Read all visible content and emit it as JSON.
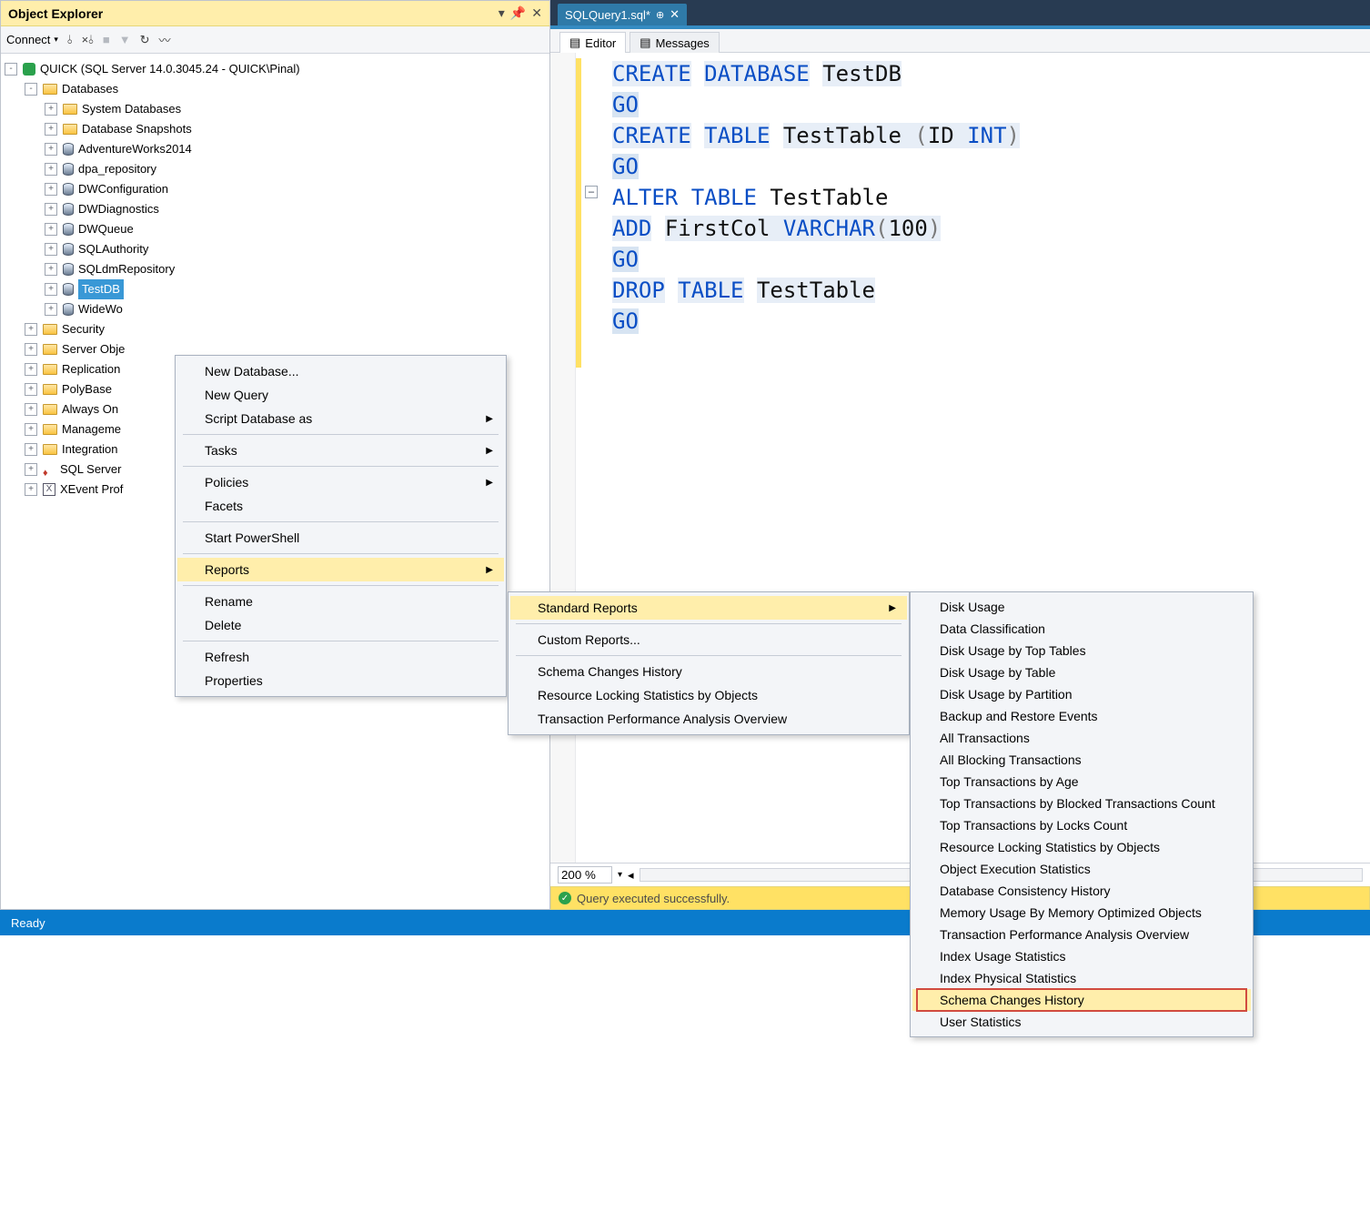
{
  "colors": {
    "accent": "#358bc2",
    "highlight_bg": "#ffeeab",
    "status_bar": "#0a7bcc",
    "warn_bar": "#ffe164",
    "red_box": "#d14b3f"
  },
  "object_explorer": {
    "title": "Object Explorer",
    "connect_label": "Connect",
    "root": "QUICK (SQL Server 14.0.3045.24 - QUICK\\Pinal)",
    "databases_label": "Databases",
    "db_children": [
      "System Databases",
      "Database Snapshots",
      "AdventureWorks2014",
      "dpa_repository",
      "DWConfiguration",
      "DWDiagnostics",
      "DWQueue",
      "SQLAuthority",
      "SQLdmRepository",
      "TestDB",
      "WideWo"
    ],
    "db_kinds": [
      "folder",
      "folder",
      "db",
      "db",
      "db",
      "db",
      "db",
      "db",
      "db",
      "db",
      "db"
    ],
    "selected_index": 9,
    "server_nodes": [
      "Security",
      "Server Obje",
      "Replication",
      "PolyBase",
      "Always On",
      "Manageme",
      "Integration",
      "SQL Server",
      "XEvent Prof"
    ],
    "server_kinds": [
      "folder",
      "folder",
      "folder",
      "folder",
      "folder",
      "folder",
      "folder",
      "sql",
      "xe"
    ]
  },
  "context_menu": {
    "items": [
      "New Database...",
      "New Query",
      "Script Database as",
      "-",
      "Tasks",
      "-",
      "Policies",
      "Facets",
      "-",
      "Start PowerShell",
      "-",
      "Reports",
      "-",
      "Rename",
      "Delete",
      "-",
      "Refresh",
      "Properties"
    ],
    "sub_arrows": [
      2,
      4,
      6,
      11
    ],
    "highlight_index": 11
  },
  "reports_menu": {
    "items": [
      "Standard Reports",
      "-",
      "Custom Reports...",
      "-",
      "Schema Changes History",
      "Resource Locking Statistics by Objects",
      "Transaction Performance Analysis Overview"
    ],
    "sub_arrows": [
      0
    ],
    "highlight_index": 0
  },
  "standard_reports_menu": {
    "items": [
      "Disk Usage",
      "Data Classification",
      "Disk Usage by Top Tables",
      "Disk Usage by Table",
      "Disk Usage by Partition",
      "Backup and Restore Events",
      "All Transactions",
      "All Blocking Transactions",
      "Top Transactions by Age",
      "Top Transactions by Blocked Transactions Count",
      "Top Transactions by Locks Count",
      "Resource Locking Statistics by Objects",
      "Object Execution Statistics",
      "Database Consistency History",
      "Memory Usage By Memory Optimized Objects",
      "Transaction Performance Analysis Overview",
      "Index Usage Statistics",
      "Index Physical Statistics",
      "Schema Changes History",
      "User Statistics"
    ],
    "boxed_index": 18
  },
  "editor": {
    "tab_label": "SQLQuery1.sql*",
    "subtab_editor": "Editor",
    "subtab_messages": "Messages",
    "zoom": "200 %",
    "status_text": "Query executed successfully.",
    "sql_tokens": [
      [
        [
          "kw",
          "CREATE"
        ],
        [
          "sp",
          " "
        ],
        [
          "kw",
          "DATABASE"
        ],
        [
          "sp",
          " "
        ],
        [
          "plain",
          "TestDB"
        ]
      ],
      [
        [
          "kw",
          "GO"
        ]
      ],
      [
        [
          "kw",
          "CREATE"
        ],
        [
          "sp",
          " "
        ],
        [
          "kw",
          "TABLE"
        ],
        [
          "sp",
          " "
        ],
        [
          "plain",
          "TestTable "
        ],
        [
          "paren",
          "("
        ],
        [
          "plain",
          "ID "
        ],
        [
          "kw",
          "INT"
        ],
        [
          "paren",
          ")"
        ]
      ],
      [
        [
          "kw",
          "GO"
        ]
      ],
      [
        [
          "kw",
          "ALTER"
        ],
        [
          "sp",
          " "
        ],
        [
          "kw",
          "TABLE"
        ],
        [
          "sp",
          " "
        ],
        [
          "plain",
          "TestTable"
        ]
      ],
      [
        [
          "kw",
          "ADD"
        ],
        [
          "sp",
          " "
        ],
        [
          "plain",
          "FirstCol "
        ],
        [
          "kw",
          "VARCHAR"
        ],
        [
          "paren",
          "("
        ],
        [
          "plain",
          "100"
        ],
        [
          "paren",
          ")"
        ]
      ],
      [
        [
          "kw",
          "GO"
        ]
      ],
      [
        [
          "kw",
          "DROP"
        ],
        [
          "sp",
          " "
        ],
        [
          "kw",
          "TABLE"
        ],
        [
          "sp",
          " "
        ],
        [
          "plain",
          "TestTable"
        ]
      ],
      [
        [
          "kw",
          "GO"
        ]
      ]
    ],
    "line_bg": [
      "sel2",
      "sel1",
      "sel2",
      "sel1",
      "",
      "sel2",
      "sel1",
      "sel2",
      "sel1"
    ]
  },
  "ready_text": "Ready"
}
